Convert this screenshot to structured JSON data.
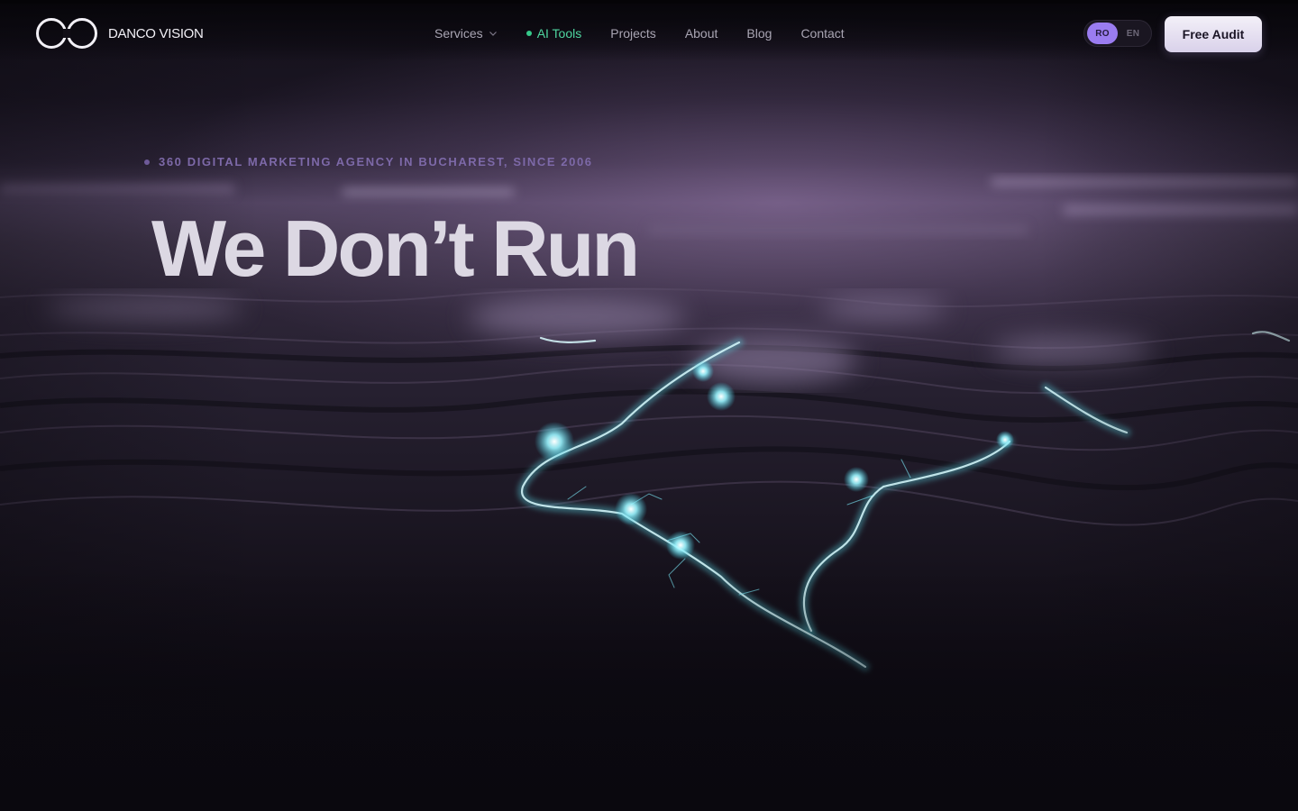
{
  "brand": {
    "name": "DANCO VISION",
    "logo_icon": "infinity-loop-icon"
  },
  "nav": {
    "items": [
      {
        "label": "Services",
        "has_dropdown": true
      },
      {
        "label": "AI Tools",
        "highlight": true
      },
      {
        "label": "Projects"
      },
      {
        "label": "About"
      },
      {
        "label": "Blog"
      },
      {
        "label": "Contact"
      }
    ]
  },
  "language": {
    "options": [
      "RO",
      "EN"
    ],
    "selected": "RO"
  },
  "cta": {
    "label": "Free Audit"
  },
  "hero": {
    "eyebrow": "360 DIGITAL MARKETING AGENCY IN BUCHAREST, SINCE 2006",
    "headline": "We Don’t Run"
  },
  "colors": {
    "accent_purple": "#9a7cf0",
    "ai_green": "#36c88a",
    "river_glow": "#8ff6ff",
    "background": "#0b0910"
  }
}
